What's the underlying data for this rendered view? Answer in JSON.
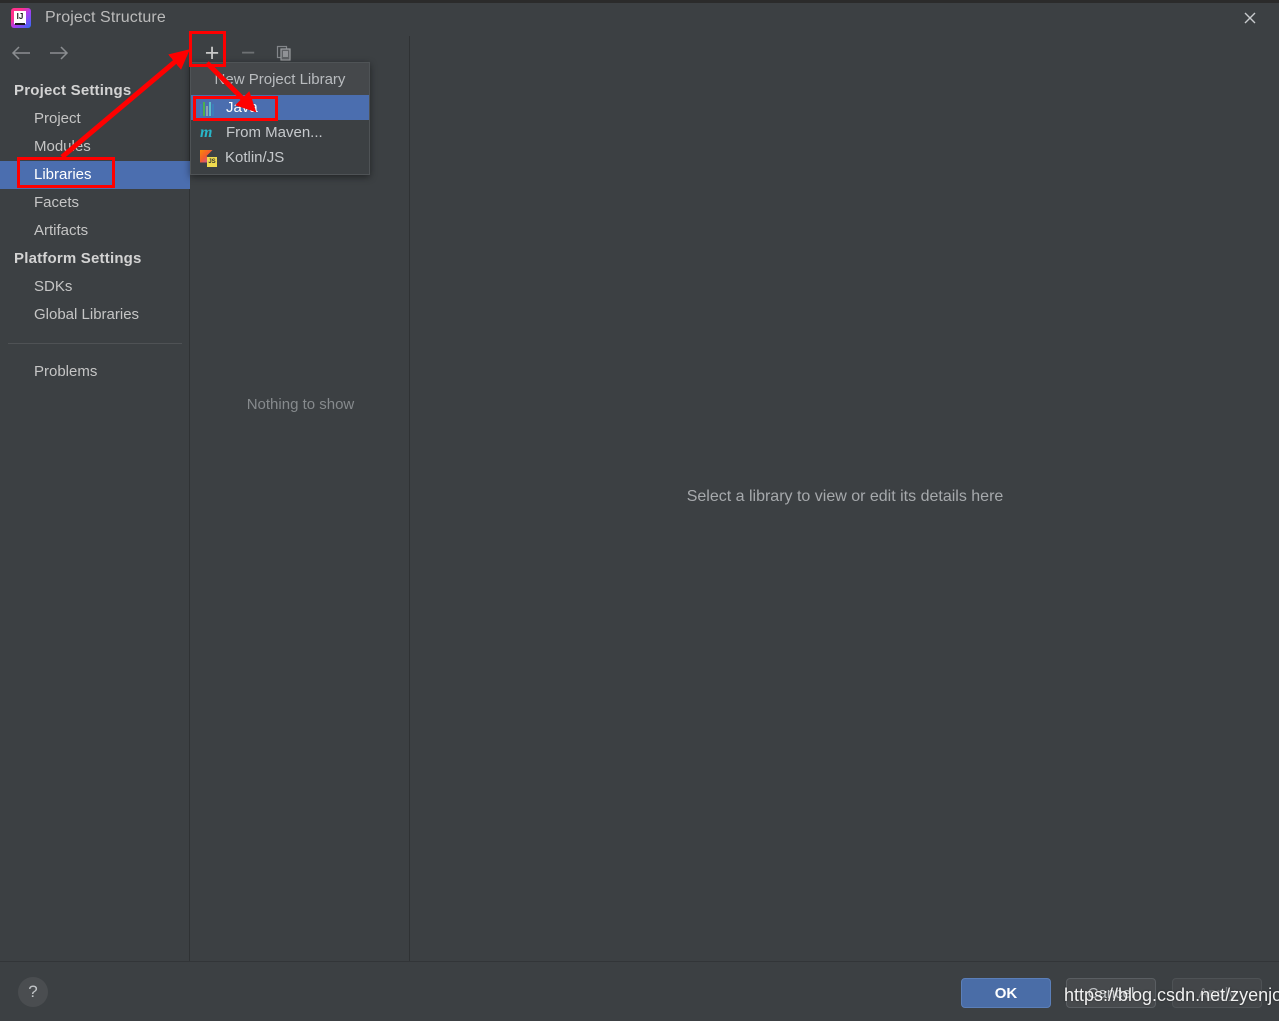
{
  "window": {
    "title": "Project Structure",
    "logo_text": "IJ",
    "close_icon": "close-icon"
  },
  "navigation": {
    "back_icon": "arrow-left-icon",
    "forward_icon": "arrow-right-icon"
  },
  "sidebar": {
    "groups": [
      {
        "title": "Project Settings",
        "items": [
          {
            "label": "Project",
            "selected": false
          },
          {
            "label": "Modules",
            "selected": false
          },
          {
            "label": "Libraries",
            "selected": true
          },
          {
            "label": "Facets",
            "selected": false
          },
          {
            "label": "Artifacts",
            "selected": false
          }
        ]
      },
      {
        "title": "Platform Settings",
        "items": [
          {
            "label": "SDKs",
            "selected": false
          },
          {
            "label": "Global Libraries",
            "selected": false
          }
        ]
      }
    ],
    "problems": {
      "label": "Problems",
      "selected": false
    }
  },
  "list_pane": {
    "toolbar": {
      "add_label": "+",
      "add_icon": "plus-icon",
      "remove_label": "−",
      "remove_icon": "minus-icon",
      "remove_disabled": true,
      "copy_icon": "copy-icon"
    },
    "empty_text": "Nothing to show"
  },
  "detail_pane": {
    "message": "Select a library to view or edit its details here"
  },
  "popup_menu": {
    "header": "New Project Library",
    "items": [
      {
        "label": "Java",
        "icon": "java-icon",
        "highlighted": true
      },
      {
        "label": "From Maven...",
        "icon": "maven-icon",
        "highlighted": false
      },
      {
        "label": "Kotlin/JS",
        "icon": "kotlin-js-icon",
        "highlighted": false
      }
    ]
  },
  "footer": {
    "help_label": "?",
    "help_icon": "help-icon",
    "buttons": [
      {
        "label": "OK",
        "style": "primary",
        "disabled": false
      },
      {
        "label": "Cancel",
        "style": "default",
        "disabled": false
      },
      {
        "label": "Apply",
        "style": "default",
        "disabled": true
      }
    ]
  },
  "annotations": {
    "color": "#ff0000",
    "boxes": [
      "libraries-item",
      "add-button",
      "java-menu-item"
    ],
    "arrows": [
      {
        "from": "libraries-item",
        "to": "add-button"
      },
      {
        "from": "add-button",
        "to": "java-menu-item"
      }
    ]
  },
  "watermark": {
    "text": "https://blog.csdn.net/zyenjoy"
  },
  "colors": {
    "window_bg": "#3c4043",
    "selection": "#4b6eaf",
    "primary_button": "#4a6da7",
    "annotation": "#ff0000",
    "text": "#c5c5c5"
  }
}
